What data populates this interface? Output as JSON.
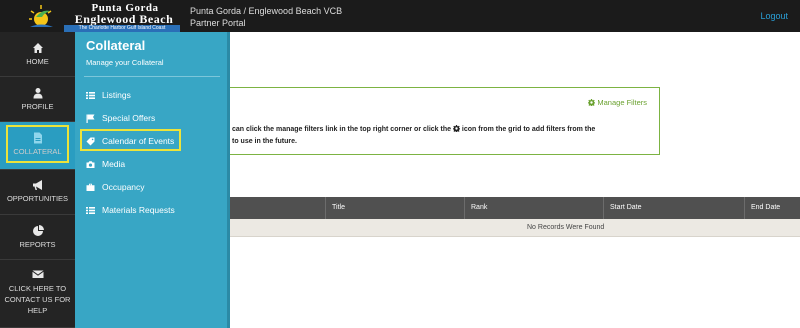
{
  "logo": {
    "line1": "Punta Gorda",
    "line2": "Englewood Beach",
    "tagline": "The Charlotte Harbor Gulf Island Coast"
  },
  "header": {
    "portal_title": "Punta Gorda / Englewood Beach VCB Partner Portal",
    "logout_label": "Logout"
  },
  "leftnav": {
    "items": [
      {
        "label": "HOME",
        "icon": "home-icon"
      },
      {
        "label": "PROFILE",
        "icon": "user-icon"
      },
      {
        "label": "COLLATERAL",
        "icon": "document-icon",
        "active": true
      },
      {
        "label": "OPPORTUNITIES",
        "icon": "megaphone-icon"
      },
      {
        "label": "REPORTS",
        "icon": "pie-chart-icon"
      },
      {
        "label": "CLICK HERE TO CONTACT US FOR HELP",
        "icon": "envelope-icon"
      }
    ]
  },
  "subnav": {
    "title": "Collateral",
    "subtitle": "Manage your Collateral",
    "items": [
      {
        "label": "Listings",
        "icon": "list-icon"
      },
      {
        "label": "Special Offers",
        "icon": "flag-icon"
      },
      {
        "label": "Calendar of Events",
        "icon": "tag-icon",
        "highlighted": true
      },
      {
        "label": "Media",
        "icon": "camera-icon"
      },
      {
        "label": "Occupancy",
        "icon": "briefcase-icon"
      },
      {
        "label": "Materials Requests",
        "icon": "list-icon"
      }
    ]
  },
  "main": {
    "manage_filters_label": "Manage Filters",
    "info_text_part1": "can click the manage filters link in the top right corner or click the",
    "info_text_part2": "icon from the grid to add filters from the",
    "info_text_line2": "to use in the future.",
    "grid": {
      "columns": [
        "Title",
        "Rank",
        "Start Date",
        "End Date"
      ],
      "empty_message": "No Records Were Found"
    }
  },
  "colors": {
    "topbar": "#1b1b1b",
    "leftnav": "#242424",
    "subnav": "#38a6c5",
    "highlight": "#ece33a",
    "filter_green": "#6aa12f",
    "grid_header": "#505050"
  }
}
